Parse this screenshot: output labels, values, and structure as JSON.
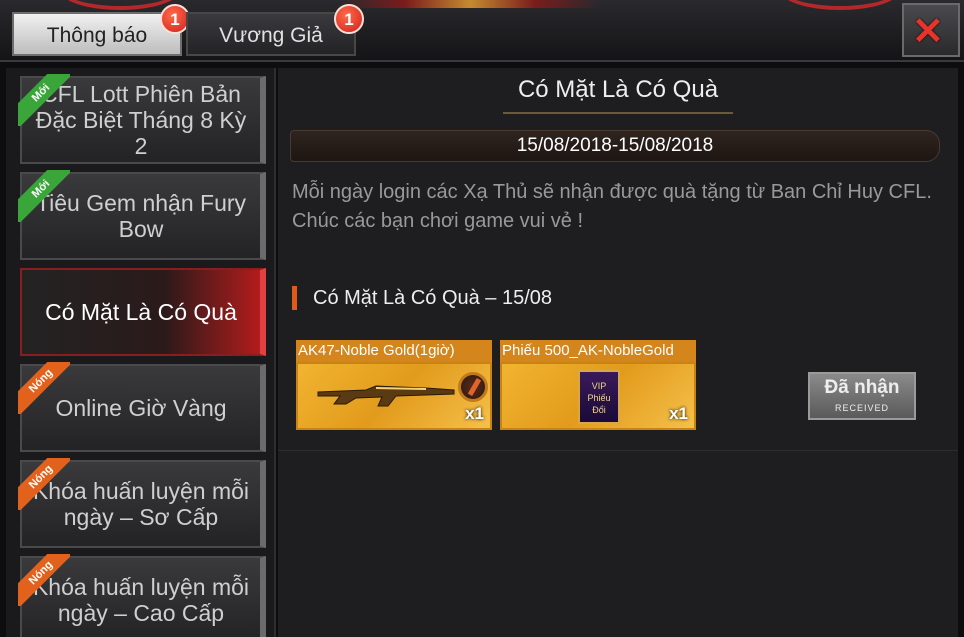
{
  "tabs": [
    {
      "label": "Thông báo",
      "badge": "1",
      "active": true
    },
    {
      "label": "Vương Giả",
      "badge": "1",
      "active": false
    }
  ],
  "close_label": "✕",
  "sidebar": {
    "items": [
      {
        "label": "CFL Lott Phiên Bản Đặc Biệt Tháng 8 Kỳ 2",
        "tag": "Mới",
        "tag_color": "#3aa63a"
      },
      {
        "label": "Tiêu Gem nhận Fury Bow",
        "tag": "Mới",
        "tag_color": "#3aa63a"
      },
      {
        "label": "Có Mặt Là Có Quà",
        "tag": "",
        "active": true
      },
      {
        "label": "Online Giờ Vàng",
        "tag": "Nóng",
        "tag_color": "#e2621d"
      },
      {
        "label": "Khóa huấn luyện mỗi ngày – Sơ Cấp",
        "tag": "Nóng",
        "tag_color": "#e2621d"
      },
      {
        "label": "Khóa huấn luyện mỗi ngày – Cao Cấp",
        "tag": "Nóng",
        "tag_color": "#e2621d"
      }
    ]
  },
  "main": {
    "title": "Có Mặt Là Có Quà",
    "date_range": "15/08/2018-15/08/2018",
    "description_line1": "Mỗi ngày login các Xạ Thủ sẽ nhận được quà tặng từ Ban Chỉ Huy CFL.",
    "description_line2": "Chúc các bạn chơi game vui vẻ !",
    "subheading": "Có Mặt Là Có Quà – 15/08",
    "rewards": [
      {
        "name": "AK47-Noble Gold(1giờ)",
        "qty": "x1"
      },
      {
        "name": "Phiếu 500_AK-NobleGold",
        "qty": "x1",
        "card_top": "VIP",
        "card_bottom": "Phiếu Đổi"
      }
    ],
    "received_label": "Đã nhận",
    "received_sub": "RECEIVED"
  },
  "colors": {
    "accent_red": "#b21c1c",
    "reward_gold": "#e29b1c",
    "tag_new": "#3aa63a",
    "tag_hot": "#e2621d"
  }
}
